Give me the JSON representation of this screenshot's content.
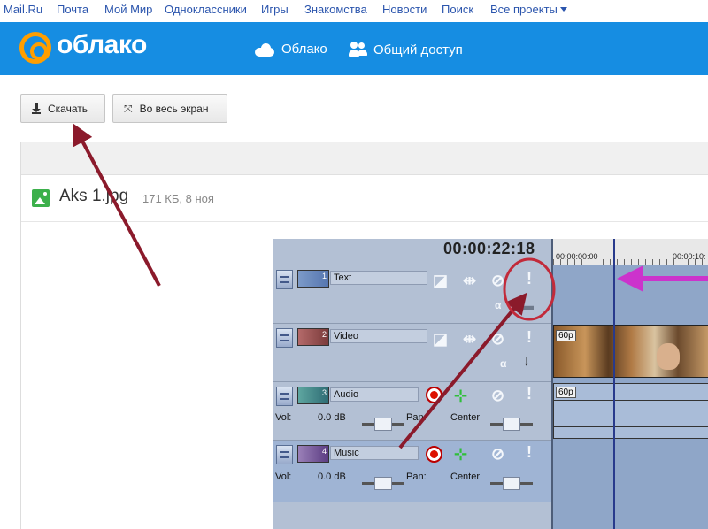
{
  "portal_nav": [
    {
      "label": "Mail.Ru"
    },
    {
      "label": "Почта"
    },
    {
      "label": "Мой Мир"
    },
    {
      "label": "Одноклассники"
    },
    {
      "label": "Игры"
    },
    {
      "label": "Знакомства"
    },
    {
      "label": "Новости"
    },
    {
      "label": "Поиск"
    },
    {
      "label": "Все проекты"
    }
  ],
  "header": {
    "logo_text": "облако",
    "nav_cloud": "Облако",
    "nav_shared": "Общий доступ",
    "brand_color": "#168de2",
    "logo_color": "#ff9e00"
  },
  "toolbar": {
    "download_label": "Скачать",
    "fullscreen_label": "Во весь экран"
  },
  "file": {
    "name": "Aks 1.jpg",
    "meta": "171 КБ, 8 ноя"
  },
  "editor": {
    "timecode": "00:00:22:18",
    "ruler": [
      "00:00:00:00",
      "00:00:10:"
    ],
    "tracks": [
      {
        "num": "1",
        "name": "Text"
      },
      {
        "num": "2",
        "name": "Video"
      },
      {
        "num": "3",
        "name": "Audio",
        "vol_label": "Vol:",
        "vol_value": "0.0 dB",
        "pan_label": "Pan:",
        "pan_value": "Center"
      },
      {
        "num": "4",
        "name": "Music",
        "vol_label": "Vol:",
        "vol_value": "0.0 dB",
        "pan_label": "Pan:",
        "pan_value": "Center"
      }
    ],
    "clip_labels": [
      "60p",
      "60p"
    ]
  },
  "annotation_color": "#8b1a2b",
  "highlight_color": "#c22a3a",
  "pointer_color": "#cc33cc"
}
